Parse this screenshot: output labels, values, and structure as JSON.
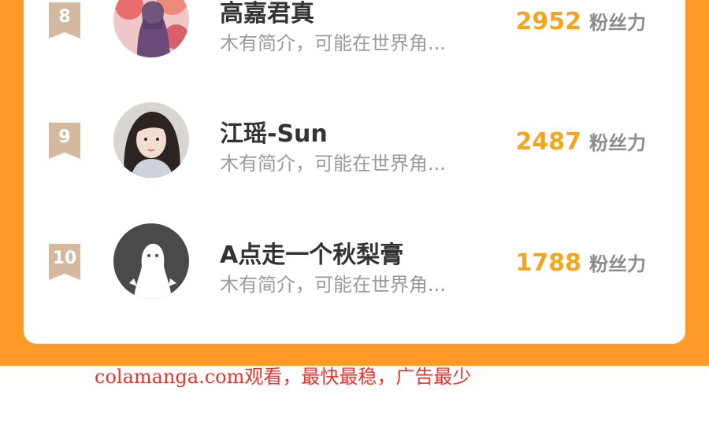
{
  "ranking": [
    {
      "rank": "8",
      "name": "高嘉君真",
      "bio": "木有简介，可能在世界角...",
      "fans": "2952",
      "fans_label": "粉丝力",
      "avatar": "illustrated-girl-avatar"
    },
    {
      "rank": "9",
      "name": "江瑶-Sun",
      "bio": "木有简介，可能在世界角...",
      "fans": "2487",
      "fans_label": "粉丝力",
      "avatar": "photo-girl-avatar"
    },
    {
      "rank": "10",
      "name": "A点走一个秋梨膏",
      "bio": "木有简介，可能在世界角...",
      "fans": "1788",
      "fans_label": "粉丝力",
      "avatar": "default-ghost-avatar"
    }
  ],
  "footer": {
    "text": "colamanga.com观看，最快最稳，广告最少"
  },
  "colors": {
    "accent": "#ff9a26",
    "fans_number": "#f4a51c",
    "rank_badge": "#d4b9a0",
    "footer_text": "#e8332e"
  }
}
